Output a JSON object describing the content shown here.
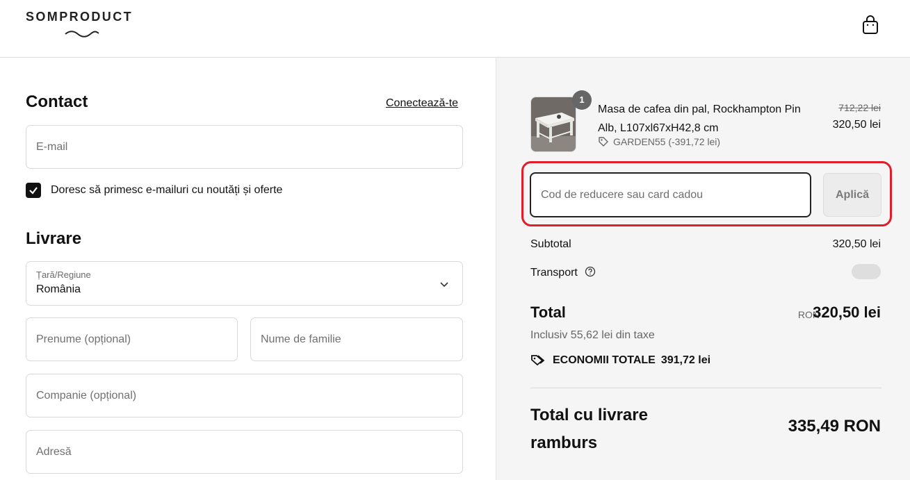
{
  "header": {
    "logo_text": "SOMPRODUCT",
    "cart_icon": "shopping-bag-icon"
  },
  "contact": {
    "heading": "Contact",
    "login_link": "Conectează-te",
    "email_placeholder": "E-mail",
    "newsletter_checked": true,
    "newsletter_label": "Doresc să primesc e-mailuri cu noutăți și oferte"
  },
  "delivery": {
    "heading": "Livrare",
    "country_label": "Țară/Regiune",
    "country_value": "România",
    "first_name_placeholder": "Prenume (opțional)",
    "last_name_placeholder": "Nume de familie",
    "company_placeholder": "Companie (opțional)",
    "address_placeholder": "Adresă"
  },
  "summary": {
    "item": {
      "quantity": "1",
      "name": "Masa de cafea din pal, Rockhampton Pin Alb, L107xl67xH42,8 cm",
      "discount_code": "GARDEN55 (-391,72 lei)",
      "old_price": "712,22 lei",
      "price": "320,50 lei"
    },
    "discount_placeholder": "Cod de reducere sau card cadou",
    "apply_label": "Aplică",
    "subtotal_label": "Subtotal",
    "subtotal_value": "320,50 lei",
    "shipping_label": "Transport",
    "total_label": "Total",
    "total_currency": "RON",
    "total_value": "320,50 lei",
    "tax_note": "Inclusiv 55,62 lei din taxe",
    "savings_label": "ECONOMII TOTALE",
    "savings_value": "391,72 lei",
    "cod_label": "Total cu livrare ramburs",
    "cod_value": "335,49 RON"
  },
  "colors": {
    "highlight": "#e11d2a",
    "summary_bg": "#f5f5f5"
  }
}
